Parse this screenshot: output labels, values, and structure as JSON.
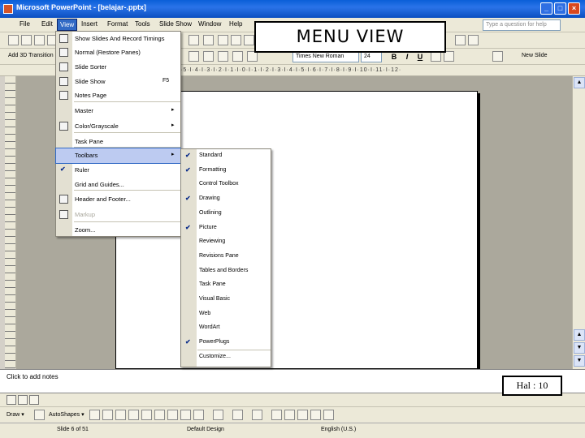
{
  "titlebar": {
    "title": "Microsoft PowerPoint - [belajar-.pptx]",
    "minimize": "_",
    "maximize": "□",
    "close": "×"
  },
  "menubar": {
    "items": [
      "File",
      "Edit",
      "View",
      "Insert",
      "Format",
      "Tools",
      "Slide Show",
      "Window",
      "Help"
    ],
    "help_placeholder": "Type a question for help"
  },
  "toolbar1": {
    "zoom": ""
  },
  "toolbar2": {
    "first_label": "Add 3D   Transition",
    "font_name": "Times New Roman",
    "font_size": "24",
    "bold": "B",
    "italic": "I",
    "underline": "U",
    "new_slide": "New Slide"
  },
  "ruler": {
    "ticks": "·5·I·4·I·3·I·2·I·1·I·0·I·1·I·2·I·3·I·4·I·5·I·6·I·7·I·8·I·9·I·10·I·11·I·12·"
  },
  "overlay": {
    "title": "MENU VIEW",
    "page_number": "Hal : 10"
  },
  "notes": {
    "placeholder": "Click to add notes"
  },
  "view_menu": {
    "items": [
      {
        "label": "Show Slides And Record Timings",
        "icon": "record-icon",
        "type": "icon"
      },
      {
        "label": "Normal (Restore Panes)",
        "icon": "normal-view-icon",
        "type": "icon"
      },
      {
        "label": "Slide Sorter",
        "icon": "slide-sorter-icon",
        "type": "icon"
      },
      {
        "label": "Slide Show",
        "shortcut": "F5",
        "icon": "slide-show-icon",
        "type": "icon"
      },
      {
        "label": "Notes Page",
        "icon": "notes-page-icon",
        "type": "icon"
      },
      {
        "label": "Master",
        "submenu": "▸",
        "type": "plain"
      },
      {
        "label": "Color/Grayscale",
        "submenu": "▸",
        "icon": "color-grayscale-icon",
        "type": "icon"
      },
      {
        "label": "Task Pane",
        "type": "plain"
      },
      {
        "label": "Toolbars",
        "submenu": "▸",
        "type": "plain",
        "highlight": true
      },
      {
        "label": "Ruler",
        "check": "✔",
        "type": "check"
      },
      {
        "label": "Grid and Guides...",
        "type": "plain"
      },
      {
        "label": "Header and Footer...",
        "icon": "header-footer-icon",
        "type": "icon"
      },
      {
        "label": "Markup",
        "icon": "markup-icon",
        "type": "icon",
        "disabled": true
      },
      {
        "label": "Zoom...",
        "type": "plain"
      }
    ]
  },
  "toolbars_menu": {
    "items": [
      {
        "label": "Standard",
        "checked": true
      },
      {
        "label": "Formatting",
        "checked": true
      },
      {
        "label": "Control Toolbox",
        "checked": false
      },
      {
        "label": "Drawing",
        "checked": true
      },
      {
        "label": "Outlining",
        "checked": false
      },
      {
        "label": "Picture",
        "checked": true
      },
      {
        "label": "Reviewing",
        "checked": false
      },
      {
        "label": "Revisions Pane",
        "checked": false
      },
      {
        "label": "Tables and Borders",
        "checked": false
      },
      {
        "label": "Task Pane",
        "checked": false
      },
      {
        "label": "Visual Basic",
        "checked": false
      },
      {
        "label": "Web",
        "checked": false
      },
      {
        "label": "WordArt",
        "checked": false
      },
      {
        "label": "PowerPlugs",
        "checked": true
      },
      {
        "label": "Customize...",
        "checked": false
      }
    ],
    "check_glyph": "✔"
  },
  "drawbar": {
    "draw": "Draw ▾",
    "autoshapes": "AutoShapes ▾"
  },
  "statusbar": {
    "slide": "Slide 6 of 51",
    "design": "Default Design",
    "language": "English (U.S.)"
  },
  "colors": {
    "titlebar": "#0a5fd8",
    "menu_highlight": "#bdcbf1",
    "canvas": "#aba89c"
  }
}
